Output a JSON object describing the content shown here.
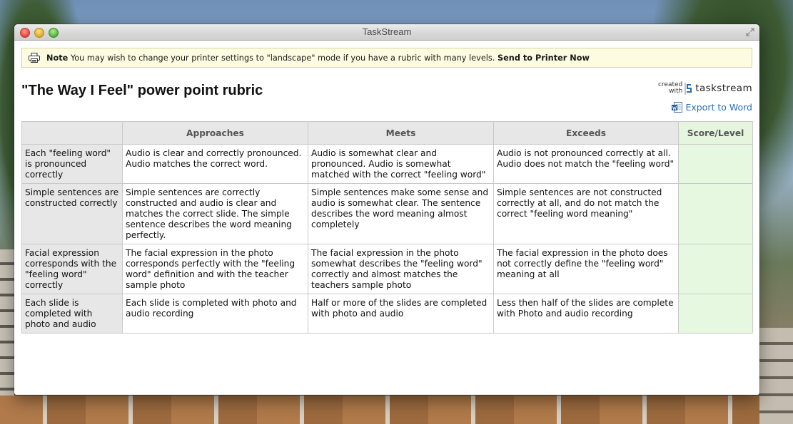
{
  "window": {
    "title": "TaskStream"
  },
  "note": {
    "label": "Note",
    "message": " You may wish to change your printer settings to \"landscape\" mode if you have a rubric with many levels. ",
    "action": "Send to Printer Now"
  },
  "page": {
    "title": "\"The Way I Feel\" power point rubric"
  },
  "brand": {
    "created_line1": "created",
    "created_line2": "with",
    "name": "taskstream"
  },
  "export": {
    "label": "Export to Word"
  },
  "rubric": {
    "columns": [
      "Approaches",
      "Meets",
      "Exceeds",
      "Score/Level"
    ],
    "rows": [
      {
        "criterion": "Each \"feeling word\" is pronounced correctly",
        "approaches": "Audio is clear and correctly pronounced. Audio matches the correct word.",
        "meets": "Audio is somewhat clear and pronounced. Audio is somewhat matched with the correct \"feeling word\"",
        "exceeds": "Audio is not pronounced correctly at all. Audio does not match the \"feeling word\"",
        "score": ""
      },
      {
        "criterion": "Simple sentences are constructed correctly",
        "approaches": "Simple sentences are correctly constructed and audio is clear and matches the correct slide. The simple sentence describes the word meaning perfectly.",
        "meets": "Simple sentences make some sense and audio is somewhat clear. The sentence describes the word meaning almost completely",
        "exceeds": "Simple sentences are not constructed correctly at all, and do not match the correct \"feeling word meaning\"",
        "score": ""
      },
      {
        "criterion": "Facial expression corresponds with the \"feeling word\" correctly",
        "approaches": "The facial expression in the photo corresponds perfectly with the \"feeling word\" definition and with the teacher sample photo",
        "meets": "The facial expression in the photo somewhat describes the \"feeling word\" correctly and almost matches the teachers sample photo",
        "exceeds": "The facial expression in the photo does not correctly define the \"feeling word\" meaning at all",
        "score": ""
      },
      {
        "criterion": "Each slide is completed with photo and audio",
        "approaches": "Each slide is completed with photo and audio recording",
        "meets": "Half or more of the slides are completed with photo and audio",
        "exceeds": "Less then half of the slides are complete with Photo and audio recording",
        "score": ""
      }
    ]
  },
  "colors": {
    "note_background": "#fdfbe0",
    "header_gray": "#e7e7e7",
    "score_green": "#e6f9e0",
    "link_blue": "#2a6fb0",
    "brand_blue": "#1f6fb4"
  }
}
